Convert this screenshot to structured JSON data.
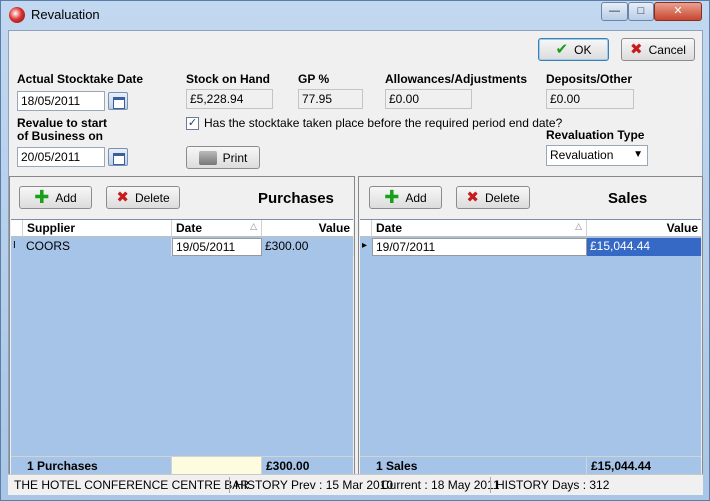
{
  "window": {
    "title": "Revaluation"
  },
  "toolbar": {
    "ok_label": "OK",
    "cancel_label": "Cancel"
  },
  "header": {
    "stocktake_date_label": "Actual Stocktake Date",
    "stocktake_date": "18/05/2011",
    "revalue_label_line1": "Revalue to start",
    "revalue_label_line2": "of Business on",
    "revalue_date": "20/05/2011",
    "stock_on_hand_label": "Stock on Hand",
    "stock_on_hand": "£5,228.94",
    "gp_label": "GP %",
    "gp_value": "77.95",
    "allowances_label": "Allowances/Adjustments",
    "allowances_value": "£0.00",
    "deposits_label": "Deposits/Other",
    "deposits_value": "£0.00",
    "checkbox_label": "Has the stocktake taken place before the required period end date?",
    "checkbox_checked": true,
    "print_label": "Print",
    "revaluation_type_label": "Revaluation Type",
    "revaluation_type": "Revaluation"
  },
  "purchases": {
    "title": "Purchases",
    "add_label": "Add",
    "delete_label": "Delete",
    "columns": [
      "Supplier",
      "Date",
      "Value"
    ],
    "rows": [
      {
        "supplier": "COORS",
        "date": "19/05/2011",
        "value": "£300.00"
      }
    ],
    "footer_count": "1 Purchases",
    "footer_total": "£300.00"
  },
  "sales": {
    "title": "Sales",
    "add_label": "Add",
    "delete_label": "Delete",
    "columns": [
      "Date",
      "Value"
    ],
    "rows": [
      {
        "date": "19/07/2011",
        "value": "£15,044.44"
      }
    ],
    "footer_count": "1 Sales",
    "footer_total": "£15,044.44"
  },
  "status": {
    "location": "THE HOTEL CONFERENCE CENTRE BAR",
    "history_prev": "HISTORY Prev : 15 Mar 2010",
    "current": "Current : 18 May 2011",
    "history_days": "HISTORY Days : 312"
  },
  "icons": {
    "app": "app-icon",
    "calendar": "calendar-icon",
    "check": "check-icon",
    "cross": "cross-icon",
    "plus": "plus-icon",
    "printer": "printer-icon"
  },
  "colors": {
    "grid_bg": "#a6c3e8",
    "selected_cell": "#3668c6",
    "title_bar": "#c2d8f0"
  }
}
